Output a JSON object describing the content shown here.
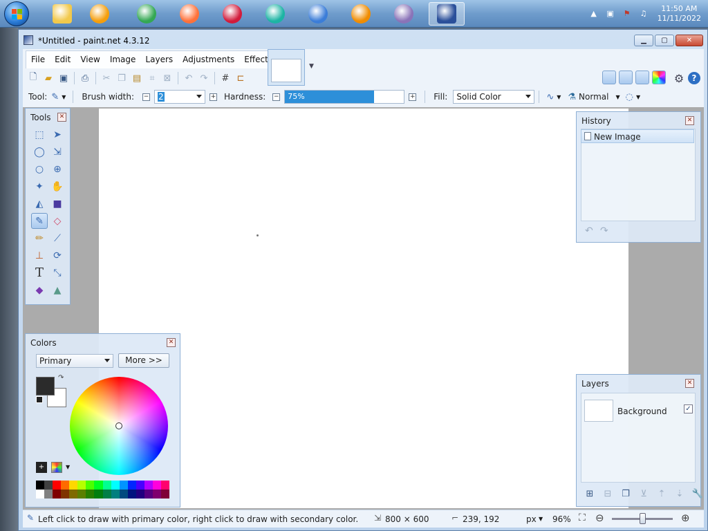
{
  "taskbar": {
    "apps": [
      {
        "name": "file-explorer",
        "color": "#f2c94c"
      },
      {
        "name": "media-player",
        "color": "#f59e0b"
      },
      {
        "name": "chrome",
        "color": "#34a853"
      },
      {
        "name": "firefox",
        "color": "#ff7139"
      },
      {
        "name": "opera",
        "color": "#d21b3b"
      },
      {
        "name": "edge",
        "color": "#1db4a4"
      },
      {
        "name": "thunderbird",
        "color": "#3b7dd8"
      },
      {
        "name": "vlc",
        "color": "#f08c00"
      },
      {
        "name": "pidgin",
        "color": "#8a73b8"
      },
      {
        "name": "paint-net",
        "color": "#2a4f9a"
      }
    ],
    "time": "11:50 AM",
    "date": "11/11/2022"
  },
  "window": {
    "title": "*Untitled - paint.net 4.3.12",
    "minimize": "▁",
    "maximize": "▢",
    "close": "✕"
  },
  "menu": [
    "File",
    "Edit",
    "View",
    "Image",
    "Layers",
    "Adjustments",
    "Effects"
  ],
  "toolbar": {
    "tool_label": "Tool:",
    "brush_width_label": "Brush width:",
    "brush_width_value": "2",
    "hardness_label": "Hardness:",
    "hardness_value": "75%",
    "hardness_fraction": 0.75,
    "fill_label": "Fill:",
    "fill_value": "Solid Color",
    "blend_mode": "Normal"
  },
  "tools_panel": {
    "title": "Tools",
    "close": "✕"
  },
  "history_panel": {
    "title": "History",
    "close": "✕",
    "items": [
      "New Image"
    ]
  },
  "layers_panel": {
    "title": "Layers",
    "close": "✕",
    "layers": [
      {
        "name": "Background",
        "visible": "✓"
      }
    ]
  },
  "colors_panel": {
    "title": "Colors",
    "close": "✕",
    "mode": "Primary",
    "more_button": "More >>",
    "primary_color": "#2b2b2b",
    "secondary_color": "#ffffff",
    "palette": [
      "#000000",
      "#404040",
      "#ff0000",
      "#ff6a00",
      "#ffd800",
      "#b6ff00",
      "#4cff00",
      "#00ff21",
      "#00ff90",
      "#00ffff",
      "#0094ff",
      "#0026ff",
      "#4800ff",
      "#b200ff",
      "#ff00dc",
      "#ff006e",
      "#ffffff",
      "#808080",
      "#7f0000",
      "#7f3300",
      "#7f6a00",
      "#5b7f00",
      "#267f00",
      "#007f0e",
      "#007f46",
      "#007f7f",
      "#004a7f",
      "#00137f",
      "#21007f",
      "#57007f",
      "#7f006e",
      "#7f0037"
    ]
  },
  "status": {
    "hint": "Left click to draw with primary color, right click to draw with secondary color.",
    "image_size": "800 × 600",
    "cursor_pos": "239, 192",
    "units": "px",
    "zoom": "96%"
  }
}
